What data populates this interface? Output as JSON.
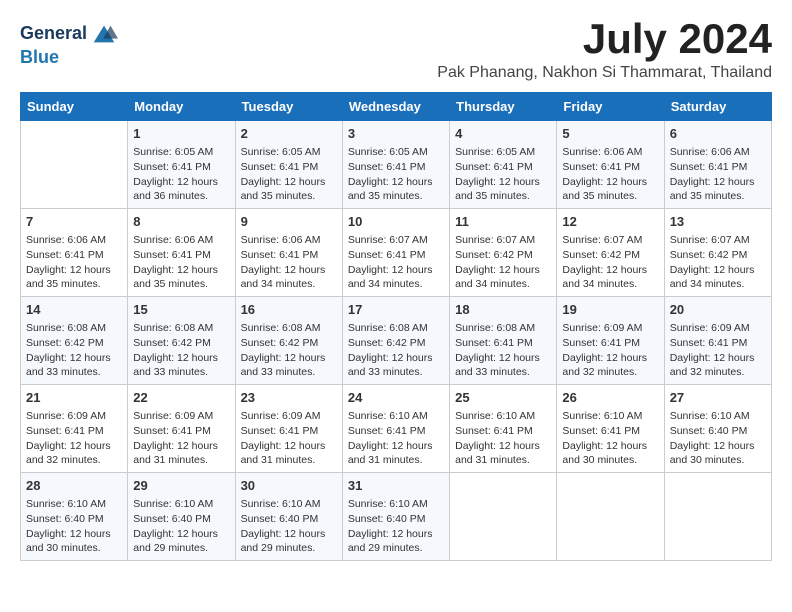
{
  "logo": {
    "line1": "General",
    "line2": "Blue"
  },
  "title": "July 2024",
  "location": "Pak Phanang, Nakhon Si Thammarat, Thailand",
  "days_of_week": [
    "Sunday",
    "Monday",
    "Tuesday",
    "Wednesday",
    "Thursday",
    "Friday",
    "Saturday"
  ],
  "weeks": [
    [
      {
        "day": "",
        "info": ""
      },
      {
        "day": "1",
        "info": "Sunrise: 6:05 AM\nSunset: 6:41 PM\nDaylight: 12 hours\nand 36 minutes."
      },
      {
        "day": "2",
        "info": "Sunrise: 6:05 AM\nSunset: 6:41 PM\nDaylight: 12 hours\nand 35 minutes."
      },
      {
        "day": "3",
        "info": "Sunrise: 6:05 AM\nSunset: 6:41 PM\nDaylight: 12 hours\nand 35 minutes."
      },
      {
        "day": "4",
        "info": "Sunrise: 6:05 AM\nSunset: 6:41 PM\nDaylight: 12 hours\nand 35 minutes."
      },
      {
        "day": "5",
        "info": "Sunrise: 6:06 AM\nSunset: 6:41 PM\nDaylight: 12 hours\nand 35 minutes."
      },
      {
        "day": "6",
        "info": "Sunrise: 6:06 AM\nSunset: 6:41 PM\nDaylight: 12 hours\nand 35 minutes."
      }
    ],
    [
      {
        "day": "7",
        "info": ""
      },
      {
        "day": "8",
        "info": "Sunrise: 6:06 AM\nSunset: 6:41 PM\nDaylight: 12 hours\nand 35 minutes."
      },
      {
        "day": "9",
        "info": "Sunrise: 6:06 AM\nSunset: 6:41 PM\nDaylight: 12 hours\nand 34 minutes."
      },
      {
        "day": "10",
        "info": "Sunrise: 6:07 AM\nSunset: 6:41 PM\nDaylight: 12 hours\nand 34 minutes."
      },
      {
        "day": "11",
        "info": "Sunrise: 6:07 AM\nSunset: 6:42 PM\nDaylight: 12 hours\nand 34 minutes."
      },
      {
        "day": "12",
        "info": "Sunrise: 6:07 AM\nSunset: 6:42 PM\nDaylight: 12 hours\nand 34 minutes."
      },
      {
        "day": "13",
        "info": "Sunrise: 6:07 AM\nSunset: 6:42 PM\nDaylight: 12 hours\nand 34 minutes."
      }
    ],
    [
      {
        "day": "14",
        "info": ""
      },
      {
        "day": "15",
        "info": "Sunrise: 6:08 AM\nSunset: 6:42 PM\nDaylight: 12 hours\nand 33 minutes."
      },
      {
        "day": "16",
        "info": "Sunrise: 6:08 AM\nSunset: 6:42 PM\nDaylight: 12 hours\nand 33 minutes."
      },
      {
        "day": "17",
        "info": "Sunrise: 6:08 AM\nSunset: 6:42 PM\nDaylight: 12 hours\nand 33 minutes."
      },
      {
        "day": "18",
        "info": "Sunrise: 6:08 AM\nSunset: 6:41 PM\nDaylight: 12 hours\nand 33 minutes."
      },
      {
        "day": "19",
        "info": "Sunrise: 6:09 AM\nSunset: 6:41 PM\nDaylight: 12 hours\nand 32 minutes."
      },
      {
        "day": "20",
        "info": "Sunrise: 6:09 AM\nSunset: 6:41 PM\nDaylight: 12 hours\nand 32 minutes."
      }
    ],
    [
      {
        "day": "21",
        "info": ""
      },
      {
        "day": "22",
        "info": "Sunrise: 6:09 AM\nSunset: 6:41 PM\nDaylight: 12 hours\nand 31 minutes."
      },
      {
        "day": "23",
        "info": "Sunrise: 6:09 AM\nSunset: 6:41 PM\nDaylight: 12 hours\nand 31 minutes."
      },
      {
        "day": "24",
        "info": "Sunrise: 6:10 AM\nSunset: 6:41 PM\nDaylight: 12 hours\nand 31 minutes."
      },
      {
        "day": "25",
        "info": "Sunrise: 6:10 AM\nSunset: 6:41 PM\nDaylight: 12 hours\nand 31 minutes."
      },
      {
        "day": "26",
        "info": "Sunrise: 6:10 AM\nSunset: 6:41 PM\nDaylight: 12 hours\nand 30 minutes."
      },
      {
        "day": "27",
        "info": "Sunrise: 6:10 AM\nSunset: 6:40 PM\nDaylight: 12 hours\nand 30 minutes."
      }
    ],
    [
      {
        "day": "28",
        "info": "Sunrise: 6:10 AM\nSunset: 6:40 PM\nDaylight: 12 hours\nand 30 minutes."
      },
      {
        "day": "29",
        "info": "Sunrise: 6:10 AM\nSunset: 6:40 PM\nDaylight: 12 hours\nand 29 minutes."
      },
      {
        "day": "30",
        "info": "Sunrise: 6:10 AM\nSunset: 6:40 PM\nDaylight: 12 hours\nand 29 minutes."
      },
      {
        "day": "31",
        "info": "Sunrise: 6:10 AM\nSunset: 6:40 PM\nDaylight: 12 hours\nand 29 minutes."
      },
      {
        "day": "",
        "info": ""
      },
      {
        "day": "",
        "info": ""
      },
      {
        "day": "",
        "info": ""
      }
    ]
  ],
  "week7_sunday_info": "Sunrise: 6:06 AM\nSunset: 6:41 PM\nDaylight: 12 hours\nand 35 minutes.",
  "week14_sunday_info": "Sunrise: 6:08 AM\nSunset: 6:42 PM\nDaylight: 12 hours\nand 33 minutes.",
  "week21_sunday_info": "Sunrise: 6:09 AM\nSunset: 6:41 PM\nDaylight: 12 hours\nand 32 minutes."
}
